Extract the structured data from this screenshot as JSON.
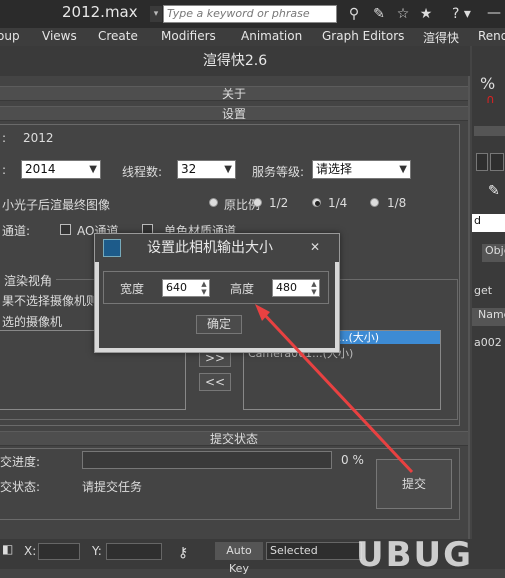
{
  "titlebar": {
    "file": "2012.max",
    "search_placeholder": "Type a keyword or phrase",
    "help": "?"
  },
  "menus": [
    "oup",
    "Views",
    "Create",
    "Modifiers",
    "Animation",
    "Graph Editors",
    "渲得快",
    "Rend"
  ],
  "plugin": {
    "title": "渲得快2.6",
    "about_bar": "关于",
    "settings_bar": "设置",
    "version_suffix": ":",
    "version_value": "2012",
    "max_version_label": ":",
    "max_version_value": "2014",
    "threads_label": "线程数:",
    "threads_value": "32",
    "service_label": "服务等级:",
    "service_value": "请选择",
    "photon_label": "小光子后渲最终图像",
    "ratio_options": [
      "原比例",
      "1/2",
      "1/4",
      "1/8"
    ],
    "ratio_selected": "1/4",
    "channels_label": "通道:",
    "ao_label": "AO通道",
    "single_material_label": "单色材质通道",
    "render_view_group": "渲染视角",
    "note_line1": "果不选择摄像机则",
    "note_line2": "选的摄像机",
    "right_list_item1": "...(大小)",
    "right_list_item2": "Camera001...(大小)",
    "add_btn": ">>",
    "remove_btn": "<<",
    "submit_bar": "提交状态",
    "progress_label": "交进度:",
    "progress_value": "0 %",
    "status_label": "交状态:",
    "status_value": "请提交任务",
    "submit_btn": "提交"
  },
  "dialog": {
    "title": "设置此相机输出大小",
    "close": "✕",
    "width_label": "宽度",
    "width_value": "640",
    "height_label": "高度",
    "height_value": "480",
    "ok_label": "确定"
  },
  "right_panel": {
    "percent": "%",
    "items": [
      "d",
      "Obje",
      "get",
      "Name",
      "a002"
    ]
  },
  "statusbar": {
    "x_label": "X:",
    "y_label": "Y:",
    "auto_key": "Auto Key",
    "selected": "Selected"
  },
  "watermark": "UBUG"
}
